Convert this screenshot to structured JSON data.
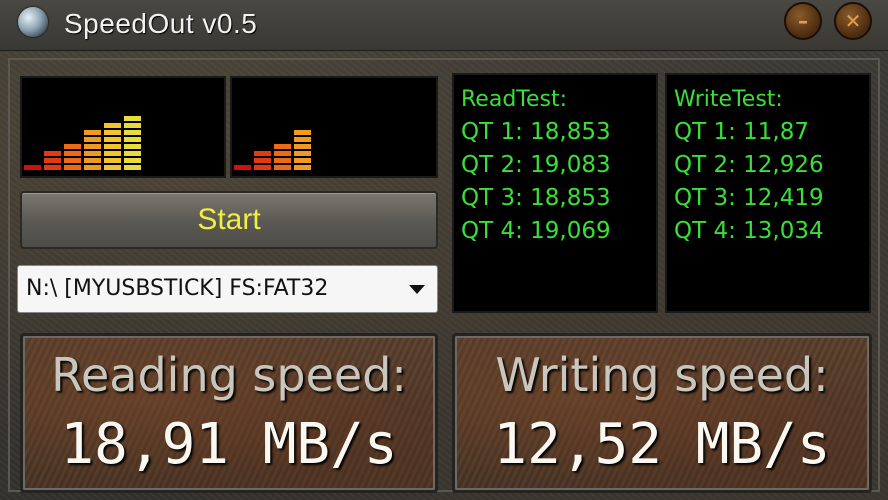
{
  "window": {
    "title": "SpeedOut v0.5",
    "icon": "globe-icon",
    "controls": {
      "minimize_icon": "minimize-icon",
      "close_icon": "close-icon"
    }
  },
  "meters": {
    "read_level": 0.78,
    "write_level": 0.55,
    "colors": [
      "#d01010",
      "#e33a10",
      "#ee6a14",
      "#f29a20",
      "#f4c42c",
      "#e8dc3a",
      "#b8e03a",
      "#7cd434"
    ]
  },
  "controls": {
    "start_label": "Start",
    "drive_selected": "N:\\ [MYUSBSTICK] FS:FAT32"
  },
  "read_test": {
    "title": "ReadTest:",
    "rows": [
      "QT 1: 18,853",
      "QT 2: 19,083",
      "QT 3: 18,853",
      "QT 4: 19,069"
    ]
  },
  "write_test": {
    "title": "WriteTest:",
    "rows": [
      "QT 1: 11,87",
      "QT 2: 12,926",
      "QT 3: 12,419",
      "QT 4: 13,034"
    ]
  },
  "reading": {
    "label": "Reading speed:",
    "value": "18,91 MB/s"
  },
  "writing": {
    "label": "Writing speed:",
    "value": "12,52 MB/s"
  },
  "colors": {
    "accent_green": "#38e038",
    "start_text": "#f2ee40"
  }
}
